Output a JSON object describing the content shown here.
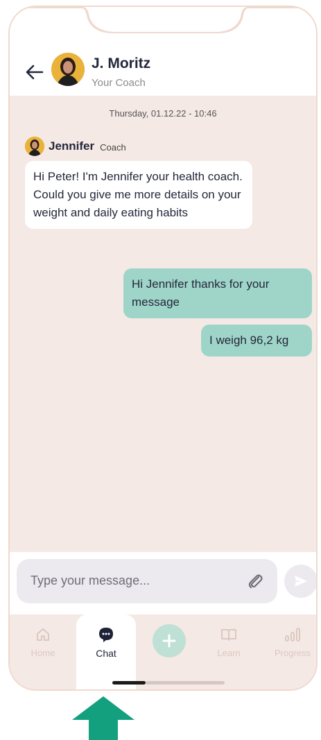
{
  "header": {
    "back_icon": "arrow-left-icon",
    "coach_name": "J. Moritz",
    "coach_role": "Your Coach"
  },
  "chat": {
    "timestamp": "Thursday, 01.12.22 - 10:46",
    "sender_name": "Jennifer",
    "sender_role": "Coach",
    "messages": [
      {
        "direction": "incoming",
        "text": "Hi Peter! I'm Jennifer your health coach. Could you give me more details on your weight and daily eating habits"
      },
      {
        "direction": "outgoing",
        "text": "Hi Jennifer thanks for your message"
      },
      {
        "direction": "outgoing",
        "text": "I weigh 96,2 kg"
      }
    ]
  },
  "composer": {
    "placeholder": "Type your message...",
    "attach_icon": "paperclip-icon",
    "send_icon": "send-icon"
  },
  "tabbar": {
    "items": [
      {
        "label": "Home",
        "icon": "home-icon",
        "active": false
      },
      {
        "label": "Chat",
        "icon": "chat-bubble-icon",
        "active": true
      },
      {
        "label": "",
        "icon": "plus-icon",
        "active": false
      },
      {
        "label": "Learn",
        "icon": "book-icon",
        "active": false
      },
      {
        "label": "Progress",
        "icon": "bar-chart-icon",
        "active": false
      }
    ]
  },
  "colors": {
    "background": "#f4e9e5",
    "outgoing_bubble": "#9fd5c9",
    "accent_arrow": "#13a07f",
    "add_button": "#bfe0d4"
  }
}
